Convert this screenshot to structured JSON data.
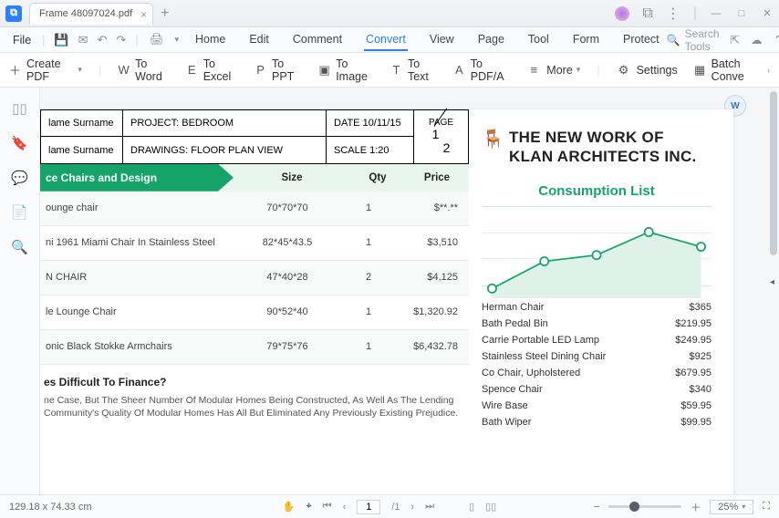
{
  "title": {
    "tab": "Frame 48097024.pdf"
  },
  "menu": {
    "file": "File",
    "tabs": [
      "Home",
      "Edit",
      "Comment",
      "Convert",
      "View",
      "Page",
      "Tool",
      "Form",
      "Protect"
    ],
    "active": "Convert",
    "search_placeholder": "Search Tools"
  },
  "toolbar": {
    "create": "Create PDF",
    "items": [
      "To Word",
      "To Excel",
      "To PPT",
      "To Image",
      "To Text",
      "To PDF/A"
    ],
    "more": "More",
    "settings": "Settings",
    "batch": "Batch Conve"
  },
  "doc_left": {
    "header": {
      "r1c1": "lame Surname",
      "r1c2": "PROJECT: BEDROOM",
      "r1c3": "DATE 10/11/15",
      "r1c4a": "PAGE",
      "r1c4b": "1",
      "r1c4c": "2",
      "r2c1": "lame Surname",
      "r2c2": "DRAWINGS: FLOOR PLAN VIEW",
      "r2c3": "SCALE 1:20"
    },
    "green_title": "ce Chairs and Design",
    "cols": {
      "size": "Size",
      "qty": "Qty",
      "price": "Price"
    },
    "rows": [
      {
        "name": "ounge chair",
        "size": "70*70*70",
        "qty": "1",
        "price": "$**.**"
      },
      {
        "name": "ni 1961 Miami Chair In Stainless Steel",
        "size": "82*45*43.5",
        "qty": "1",
        "price": "$3,510"
      },
      {
        "name": "N CHAIR",
        "size": "47*40*28",
        "qty": "2",
        "price": "$4,125"
      },
      {
        "name": "le Lounge Chair",
        "size": "90*52*40",
        "qty": "1",
        "price": "$1,320.92"
      },
      {
        "name": "onic Black Stokke Armchairs",
        "size": "79*75*76",
        "qty": "1",
        "price": "$6,432.78"
      }
    ],
    "para_head": "es Difficult To Finance?",
    "para": "ne Case, But The Sheer Number Of Modular Homes Being Constructed, As Well As The Lending Community's Quality Of Modular Homes Has All But Eliminated Any Previously Existing Prejudice."
  },
  "doc_right": {
    "brand1": "THE NEW WORK OF",
    "brand2": "KLAN ARCHITECTS INC.",
    "cons": "Consumption List",
    "list": [
      {
        "n": "Herman Chair",
        "p": "$365"
      },
      {
        "n": "Bath Pedal Bin",
        "p": "$219.95"
      },
      {
        "n": "Carrie Portable LED Lamp",
        "p": "$249.95"
      },
      {
        "n": "Stainless Steel Dining Chair",
        "p": "$925"
      },
      {
        "n": "Co Chair, Upholstered",
        "p": "$679.95"
      },
      {
        "n": "Spence Chair",
        "p": "$340"
      },
      {
        "n": "Wire Base",
        "p": "$59.95"
      },
      {
        "n": "Bath Wiper",
        "p": "$99.95"
      }
    ]
  },
  "status": {
    "dim": "129.18 x 74.33 cm",
    "page_current": "1",
    "page_total": "/1",
    "zoom": "25%"
  },
  "chart_data": {
    "type": "line",
    "title": "Consumption List",
    "x": [
      1,
      2,
      3,
      4,
      5
    ],
    "values": [
      12,
      40,
      48,
      72,
      58
    ],
    "ylim": [
      0,
      100
    ]
  }
}
